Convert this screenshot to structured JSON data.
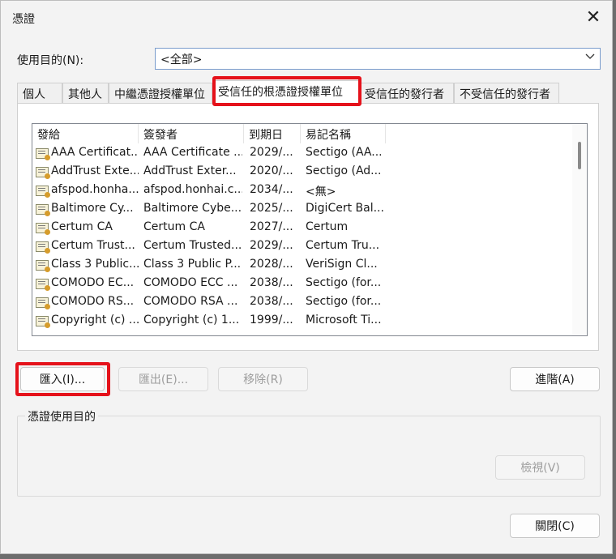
{
  "window": {
    "title": "憑證",
    "close_glyph": "✕"
  },
  "purpose": {
    "label": "使用目的(N):",
    "value": "<全部>"
  },
  "tabs": [
    "個人",
    "其他人",
    "中繼憑證授權單位",
    "受信任的根憑證授權單位",
    "受信任的發行者",
    "不受信任的發行者"
  ],
  "active_tab_index": 3,
  "list": {
    "columns": [
      "發給",
      "簽發者",
      "到期日",
      "易記名稱"
    ],
    "rows": [
      [
        "AAA Certificat...",
        "AAA Certificate ...",
        "2029/...",
        "Sectigo (AA..."
      ],
      [
        "AddTrust Exte...",
        "AddTrust Exter...",
        "2020/...",
        "Sectigo (Ad..."
      ],
      [
        "afspod.honha...",
        "afspod.honhai.c...",
        "2034/...",
        "<無>"
      ],
      [
        "Baltimore Cy...",
        "Baltimore Cybe...",
        "2025/...",
        "DigiCert Bal..."
      ],
      [
        "Certum CA",
        "Certum CA",
        "2027/...",
        "Certum"
      ],
      [
        "Certum Trust...",
        "Certum Trusted...",
        "2029/...",
        "Certum Tru..."
      ],
      [
        "Class 3 Public...",
        "Class 3 Public P...",
        "2028/...",
        "VeriSign Cl..."
      ],
      [
        "COMODO EC...",
        "COMODO ECC ...",
        "2038/...",
        "Sectigo (for..."
      ],
      [
        "COMODO RS...",
        "COMODO RSA ...",
        "2038/...",
        "Sectigo (for..."
      ],
      [
        "Copyright (c) ...",
        "Copyright (c) 1...",
        "1999/...",
        "Microsoft Ti..."
      ]
    ]
  },
  "buttons": {
    "import": "匯入(I)...",
    "export": "匯出(E)...",
    "remove": "移除(R)",
    "advanced": "進階(A)",
    "view": "檢視(V)",
    "close": "關閉(C)"
  },
  "purpose_group": {
    "label": "憑證使用目的"
  },
  "colors": {
    "highlight": "#e5121b",
    "dialog_bg": "#f3f3f3",
    "panel_bg": "#ffffff"
  },
  "icons": {
    "cert": "certificate-icon",
    "close": "close-icon",
    "dropdown": "chevron-down-icon"
  }
}
